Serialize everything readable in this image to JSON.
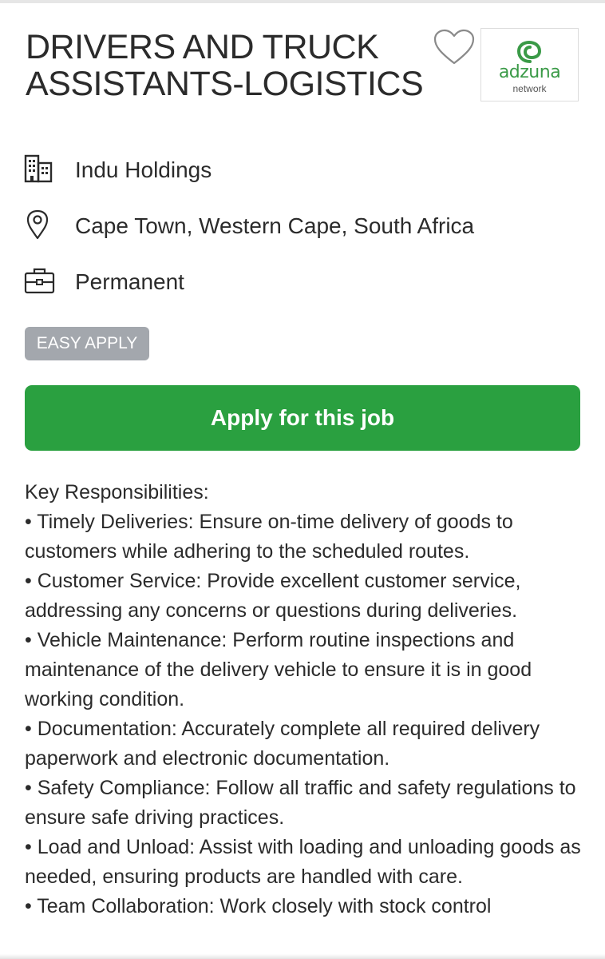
{
  "job": {
    "title": "DRIVERS AND TRUCK ASSISTANTS-LOGISTICS",
    "company": "Indu Holdings",
    "location": "Cape Town, Western Cape, South Africa",
    "job_type": "Permanent",
    "badge": "EASY APPLY",
    "apply_label": "Apply for this job"
  },
  "logo": {
    "name": "adzuna",
    "sub": "network",
    "color": "#3a9a47"
  },
  "icons": {
    "favorite": "heart-outline-icon",
    "company": "building-icon",
    "location": "map-pin-icon",
    "job_type": "briefcase-icon"
  },
  "colors": {
    "apply_button": "#2aa040",
    "badge": "#a3a7ad",
    "text": "#2b2b2b"
  },
  "description": {
    "heading": "Key Responsibilities:",
    "items": [
      "• Timely Deliveries: Ensure on-time delivery of goods to customers while adhering to the scheduled routes.",
      "• Customer Service: Provide excellent customer service, addressing any concerns or questions during deliveries.",
      "• Vehicle Maintenance: Perform routine inspections and maintenance of the delivery vehicle to ensure it is in good working condition.",
      "• Documentation: Accurately complete all required delivery paperwork and electronic documentation.",
      "• Safety Compliance: Follow all traffic and safety regulations to ensure safe driving practices.",
      "• Load and Unload: Assist with loading and unloading goods as needed, ensuring products are handled with care.",
      "• Team Collaboration: Work closely with stock control"
    ]
  }
}
